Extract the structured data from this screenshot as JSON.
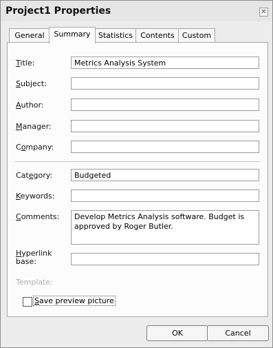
{
  "window": {
    "title": "Project1 Properties",
    "close_icon": "close-icon"
  },
  "tabs": [
    {
      "label": "General"
    },
    {
      "label": "Summary"
    },
    {
      "label": "Statistics"
    },
    {
      "label": "Contents"
    },
    {
      "label": "Custom"
    }
  ],
  "active_tab": "Summary",
  "fields": {
    "title": {
      "label_pre": "",
      "label_key": "T",
      "label_post": "itle:",
      "value": "Metrics Analysis System"
    },
    "subject": {
      "label_pre": "",
      "label_key": "S",
      "label_post": "ubject:",
      "value": ""
    },
    "author": {
      "label_pre": "",
      "label_key": "A",
      "label_post": "uthor:",
      "value": ""
    },
    "manager": {
      "label_pre": "",
      "label_key": "M",
      "label_post": "anager:",
      "value": ""
    },
    "company": {
      "label_pre": "C",
      "label_key": "o",
      "label_post": "mpany:",
      "value": ""
    },
    "category": {
      "label_pre": "Cat",
      "label_key": "e",
      "label_post": "gory:",
      "value": "Budgeted"
    },
    "keywords": {
      "label_pre": "",
      "label_key": "K",
      "label_post": "eywords:",
      "value": ""
    },
    "comments": {
      "label_pre": "",
      "label_key": "C",
      "label_post": "omments:",
      "value": "Develop Metrics Analysis software.  Budget is approved by Roger Butler."
    },
    "hyperlink": {
      "label_pre": "",
      "label_key": "H",
      "label_post": "yperlink",
      "label_line2": "base:",
      "value": ""
    },
    "template": {
      "label": "Template:"
    }
  },
  "checkbox": {
    "label_pre": "",
    "label_key": "S",
    "label_post": "ave preview picture",
    "checked": false
  },
  "buttons": {
    "ok": "OK",
    "cancel": "Cancel"
  }
}
